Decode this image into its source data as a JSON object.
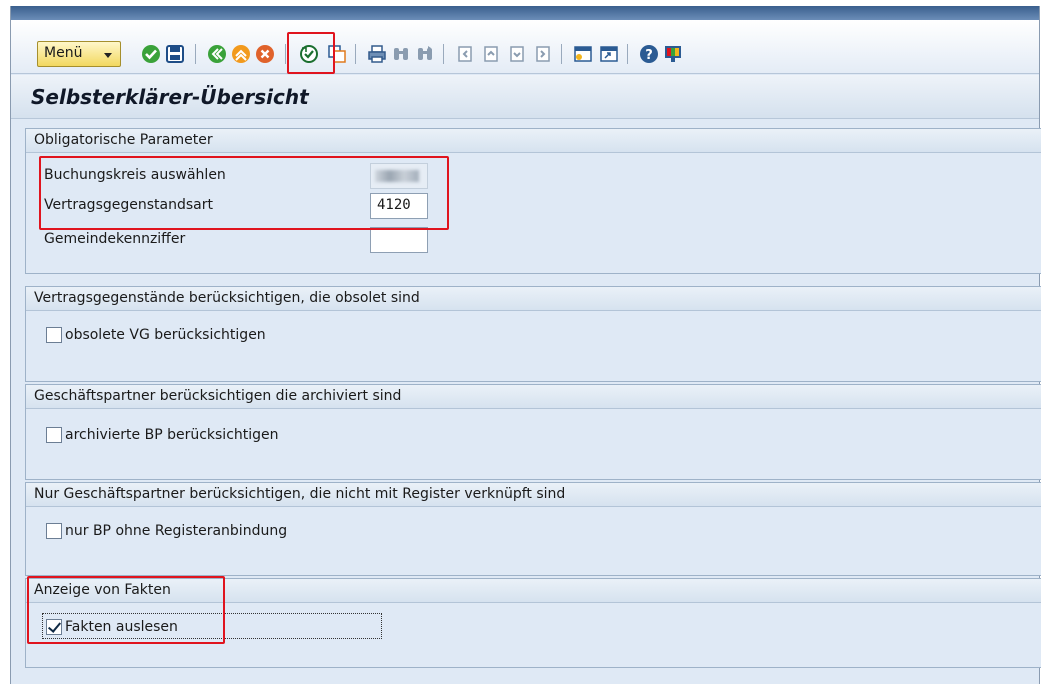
{
  "toolbar": {
    "menu_label": "Menü",
    "icons": [
      "check-icon",
      "save-icon",
      "back-icon",
      "exit-icon",
      "cancel-icon",
      "execute-icon",
      "copy-icon",
      "print-icon",
      "find-icon",
      "find-next-icon",
      "first-page-icon",
      "previous-page-icon",
      "next-page-icon",
      "last-page-icon",
      "create-session-icon",
      "shortcut-icon",
      "help-icon",
      "customize-layout-icon"
    ]
  },
  "page": {
    "title": "Selbsterklärer-Übersicht"
  },
  "groups": {
    "mandatory": {
      "header": "Obligatorische Parameter",
      "fields": [
        {
          "label": "Buchungskreis auswählen",
          "value": ""
        },
        {
          "label": "Vertragsgegenstandsart",
          "value": "4120"
        },
        {
          "label": "Gemeindekennziffer",
          "value": ""
        }
      ]
    },
    "obsolete": {
      "header": "Vertragsgegenstände berücksichtigen, die obsolet sind",
      "checkbox_label": "obsolete VG berücksichtigen",
      "checked": false
    },
    "archived": {
      "header": "Geschäftspartner berücksichtigen die archiviert sind",
      "checkbox_label": "archivierte BP berücksichtigen",
      "checked": false
    },
    "register": {
      "header": "Nur Geschäftspartner berücksichtigen, die nicht mit Register verknüpft sind",
      "checkbox_label": "nur BP ohne Registeranbindung",
      "checked": false
    },
    "facts": {
      "header": "Anzeige von Fakten",
      "checkbox_label": "Fakten auslesen",
      "checked": true
    }
  },
  "colors": {
    "highlight": "#e0141e",
    "accent": "#f2d860",
    "background": "#dfe9f5"
  }
}
